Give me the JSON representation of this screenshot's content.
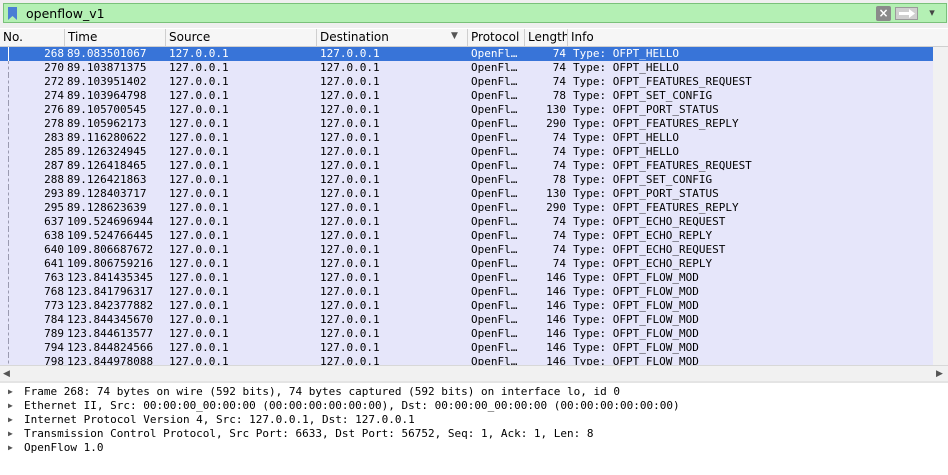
{
  "filter": {
    "text": "openflow_v1",
    "bookmark_icon": "bookmark-icon",
    "clear_icon": "clear-icon",
    "apply_icon": "apply-arrow-icon",
    "dropdown_icon": "chevron-down-icon",
    "bg_color": "#b4f0b4"
  },
  "columns": [
    "No.",
    "Time",
    "Source",
    "Destination",
    "Protocol",
    "Length",
    "Info"
  ],
  "sort_indicator": "▼",
  "packets": [
    {
      "no": "268",
      "time": "89.083501067",
      "src": "127.0.0.1",
      "dst": "127.0.0.1",
      "proto": "OpenFl…",
      "len": "74",
      "info": "Type: OFPT_HELLO",
      "selected": true
    },
    {
      "no": "270",
      "time": "89.103871375",
      "src": "127.0.0.1",
      "dst": "127.0.0.1",
      "proto": "OpenFl…",
      "len": "74",
      "info": "Type: OFPT_HELLO"
    },
    {
      "no": "272",
      "time": "89.103951402",
      "src": "127.0.0.1",
      "dst": "127.0.0.1",
      "proto": "OpenFl…",
      "len": "74",
      "info": "Type: OFPT_FEATURES_REQUEST"
    },
    {
      "no": "274",
      "time": "89.103964798",
      "src": "127.0.0.1",
      "dst": "127.0.0.1",
      "proto": "OpenFl…",
      "len": "78",
      "info": "Type: OFPT_SET_CONFIG"
    },
    {
      "no": "276",
      "time": "89.105700545",
      "src": "127.0.0.1",
      "dst": "127.0.0.1",
      "proto": "OpenFl…",
      "len": "130",
      "info": "Type: OFPT_PORT_STATUS"
    },
    {
      "no": "278",
      "time": "89.105962173",
      "src": "127.0.0.1",
      "dst": "127.0.0.1",
      "proto": "OpenFl…",
      "len": "290",
      "info": "Type: OFPT_FEATURES_REPLY"
    },
    {
      "no": "283",
      "time": "89.116280622",
      "src": "127.0.0.1",
      "dst": "127.0.0.1",
      "proto": "OpenFl…",
      "len": "74",
      "info": "Type: OFPT_HELLO"
    },
    {
      "no": "285",
      "time": "89.126324945",
      "src": "127.0.0.1",
      "dst": "127.0.0.1",
      "proto": "OpenFl…",
      "len": "74",
      "info": "Type: OFPT_HELLO"
    },
    {
      "no": "287",
      "time": "89.126418465",
      "src": "127.0.0.1",
      "dst": "127.0.0.1",
      "proto": "OpenFl…",
      "len": "74",
      "info": "Type: OFPT_FEATURES_REQUEST"
    },
    {
      "no": "288",
      "time": "89.126421863",
      "src": "127.0.0.1",
      "dst": "127.0.0.1",
      "proto": "OpenFl…",
      "len": "78",
      "info": "Type: OFPT_SET_CONFIG"
    },
    {
      "no": "293",
      "time": "89.128403717",
      "src": "127.0.0.1",
      "dst": "127.0.0.1",
      "proto": "OpenFl…",
      "len": "130",
      "info": "Type: OFPT_PORT_STATUS"
    },
    {
      "no": "295",
      "time": "89.128623639",
      "src": "127.0.0.1",
      "dst": "127.0.0.1",
      "proto": "OpenFl…",
      "len": "290",
      "info": "Type: OFPT_FEATURES_REPLY"
    },
    {
      "no": "637",
      "time": "109.524696944",
      "src": "127.0.0.1",
      "dst": "127.0.0.1",
      "proto": "OpenFl…",
      "len": "74",
      "info": "Type: OFPT_ECHO_REQUEST"
    },
    {
      "no": "638",
      "time": "109.524766445",
      "src": "127.0.0.1",
      "dst": "127.0.0.1",
      "proto": "OpenFl…",
      "len": "74",
      "info": "Type: OFPT_ECHO_REPLY"
    },
    {
      "no": "640",
      "time": "109.806687672",
      "src": "127.0.0.1",
      "dst": "127.0.0.1",
      "proto": "OpenFl…",
      "len": "74",
      "info": "Type: OFPT_ECHO_REQUEST"
    },
    {
      "no": "641",
      "time": "109.806759216",
      "src": "127.0.0.1",
      "dst": "127.0.0.1",
      "proto": "OpenFl…",
      "len": "74",
      "info": "Type: OFPT_ECHO_REPLY"
    },
    {
      "no": "763",
      "time": "123.841435345",
      "src": "127.0.0.1",
      "dst": "127.0.0.1",
      "proto": "OpenFl…",
      "len": "146",
      "info": "Type: OFPT_FLOW_MOD"
    },
    {
      "no": "768",
      "time": "123.841796317",
      "src": "127.0.0.1",
      "dst": "127.0.0.1",
      "proto": "OpenFl…",
      "len": "146",
      "info": "Type: OFPT_FLOW_MOD"
    },
    {
      "no": "773",
      "time": "123.842377882",
      "src": "127.0.0.1",
      "dst": "127.0.0.1",
      "proto": "OpenFl…",
      "len": "146",
      "info": "Type: OFPT_FLOW_MOD"
    },
    {
      "no": "784",
      "time": "123.844345670",
      "src": "127.0.0.1",
      "dst": "127.0.0.1",
      "proto": "OpenFl…",
      "len": "146",
      "info": "Type: OFPT_FLOW_MOD"
    },
    {
      "no": "789",
      "time": "123.844613577",
      "src": "127.0.0.1",
      "dst": "127.0.0.1",
      "proto": "OpenFl…",
      "len": "146",
      "info": "Type: OFPT_FLOW_MOD"
    },
    {
      "no": "794",
      "time": "123.844824566",
      "src": "127.0.0.1",
      "dst": "127.0.0.1",
      "proto": "OpenFl…",
      "len": "146",
      "info": "Type: OFPT_FLOW_MOD"
    },
    {
      "no": "798",
      "time": "123.844978088",
      "src": "127.0.0.1",
      "dst": "127.0.0.1",
      "proto": "OpenFl…",
      "len": "146",
      "info": "Type: OFPT_FLOW_MOD"
    }
  ],
  "row_color": "#e6e6fa",
  "selected_color": "#3874d8",
  "details": [
    "Frame 268: 74 bytes on wire (592 bits), 74 bytes captured (592 bits) on interface lo, id 0",
    "Ethernet II, Src: 00:00:00_00:00:00 (00:00:00:00:00:00), Dst: 00:00:00_00:00:00 (00:00:00:00:00:00)",
    "Internet Protocol Version 4, Src: 127.0.0.1, Dst: 127.0.0.1",
    "Transmission Control Protocol, Src Port: 6633, Dst Port: 56752, Seq: 1, Ack: 1, Len: 8",
    "OpenFlow 1.0"
  ],
  "expand_icon": "expand-triangle-icon"
}
